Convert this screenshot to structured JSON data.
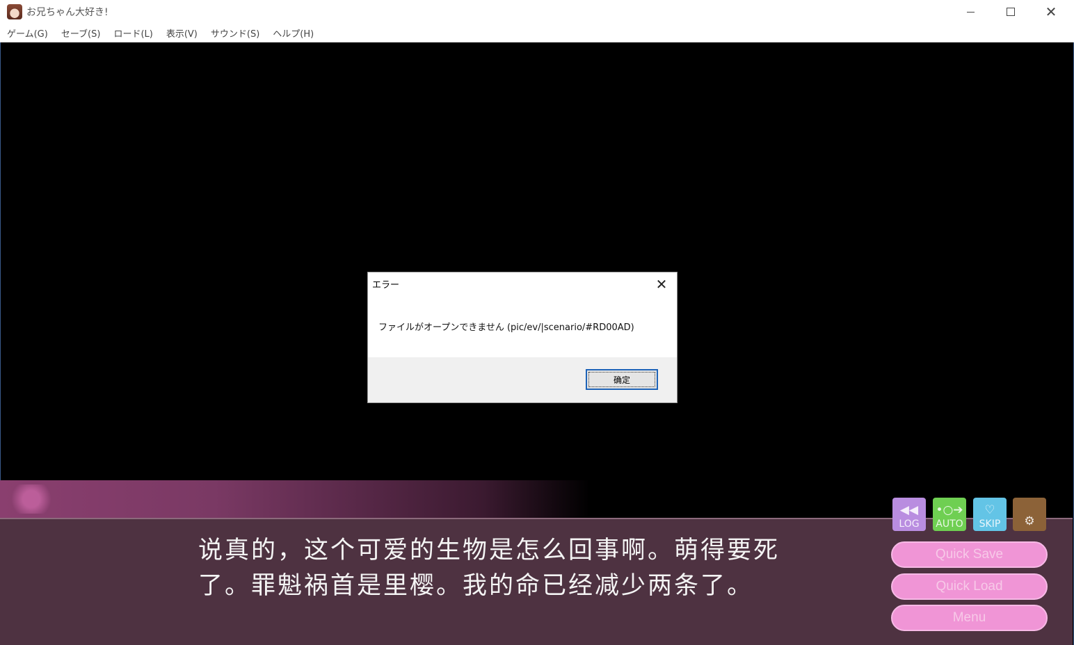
{
  "window": {
    "title": "お兄ちゃん大好き!",
    "minimize_icon": "minimize-icon",
    "maximize_icon": "maximize-icon",
    "close_glyph": "✕"
  },
  "menu": {
    "items": [
      "ゲーム(G)",
      "セーブ(S)",
      "ロード(L)",
      "表示(V)",
      "サウンド(S)",
      "ヘルプ(H)"
    ]
  },
  "dialog": {
    "title": "エラー",
    "close_glyph": "✕",
    "message": "ファイルがオープンできません (pic/ev/|scenario/#RD00AD)",
    "ok_label": "确定"
  },
  "message_window": {
    "lines": [
      "说真的，这个可爱的生物是怎么回事啊。萌得要死",
      "了。罪魁祸首是里樱。我的命已经减少两条了。"
    ]
  },
  "controls": {
    "log": {
      "label": "LOG",
      "glyph": "◀◀",
      "color": "#b98de0"
    },
    "auto": {
      "label": "AUTO",
      "glyph": "•○➔",
      "color": "#6fcf52"
    },
    "skip": {
      "label": "SKIP",
      "glyph": "♡",
      "color": "#63c4e6"
    },
    "config": {
      "label": "",
      "glyph": "⚙",
      "color": "#8c6238"
    }
  },
  "buttons": {
    "quick_save": "Quick Save",
    "quick_load": "Quick Load",
    "menu": "Menu"
  },
  "colors": {
    "message_box": "#4e3241",
    "pink_button": "#f095d6",
    "dialog_accent": "#1e63b8"
  }
}
